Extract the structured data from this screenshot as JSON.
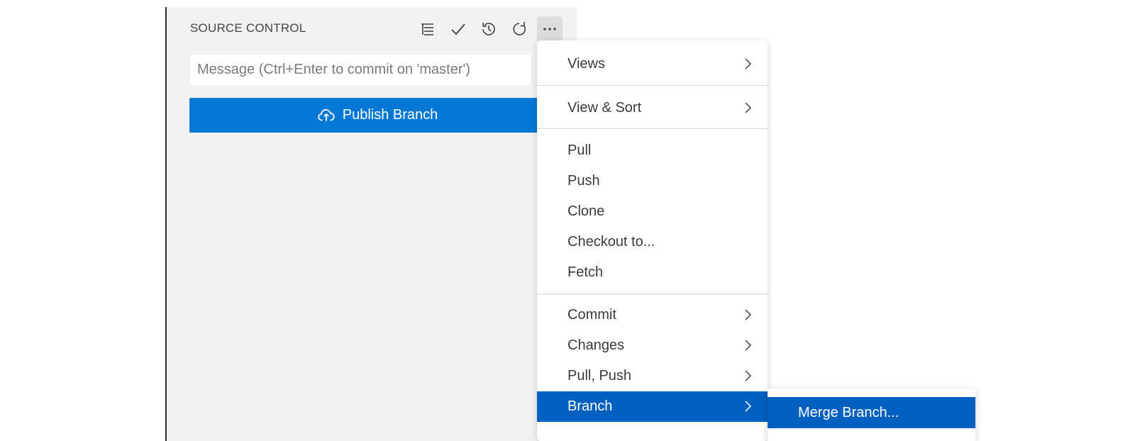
{
  "panel": {
    "title": "SOURCE CONTROL",
    "toolbar": [
      "view-as-tree-icon",
      "commit-check-icon",
      "history-icon",
      "refresh-icon",
      "more-actions-icon"
    ],
    "message_placeholder": "Message (Ctrl+Enter to commit on 'master')",
    "publish_label": "Publish Branch",
    "publish_icon": "cloud-upload-icon"
  },
  "menu": {
    "items": [
      {
        "label": "Views",
        "submenu": true
      },
      {
        "label": "View & Sort",
        "submenu": true
      },
      {
        "label": "Pull"
      },
      {
        "label": "Push"
      },
      {
        "label": "Clone"
      },
      {
        "label": "Checkout to..."
      },
      {
        "label": "Fetch"
      },
      {
        "label": "Commit",
        "submenu": true
      },
      {
        "label": "Changes",
        "submenu": true
      },
      {
        "label": "Pull, Push",
        "submenu": true
      },
      {
        "label": "Branch",
        "submenu": true,
        "highlighted": true
      }
    ]
  },
  "submenu": {
    "items": [
      {
        "label": "Merge Branch...",
        "highlighted": true
      }
    ]
  },
  "colors": {
    "accent": "#0078d4",
    "highlight": "#0060c0",
    "panel_bg": "#f2f2f2"
  }
}
